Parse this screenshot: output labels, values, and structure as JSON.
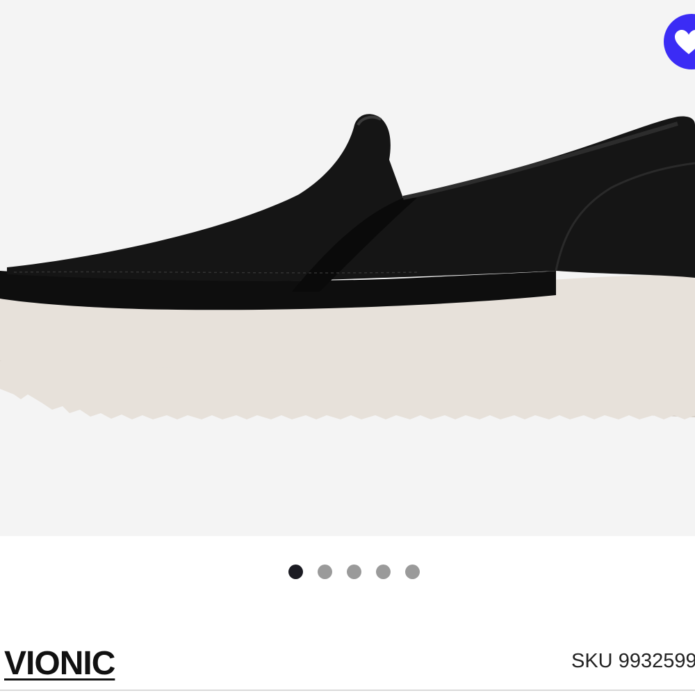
{
  "product": {
    "image_alt": "Black leather slip-on platform sneaker",
    "brand": "VIONIC",
    "sku_label": "SKU",
    "sku_value": "9932599"
  },
  "gallery": {
    "total_images": 5,
    "active_index": 0
  },
  "favorite": {
    "icon": "heart-icon",
    "accent_color": "#3b2cf5"
  }
}
